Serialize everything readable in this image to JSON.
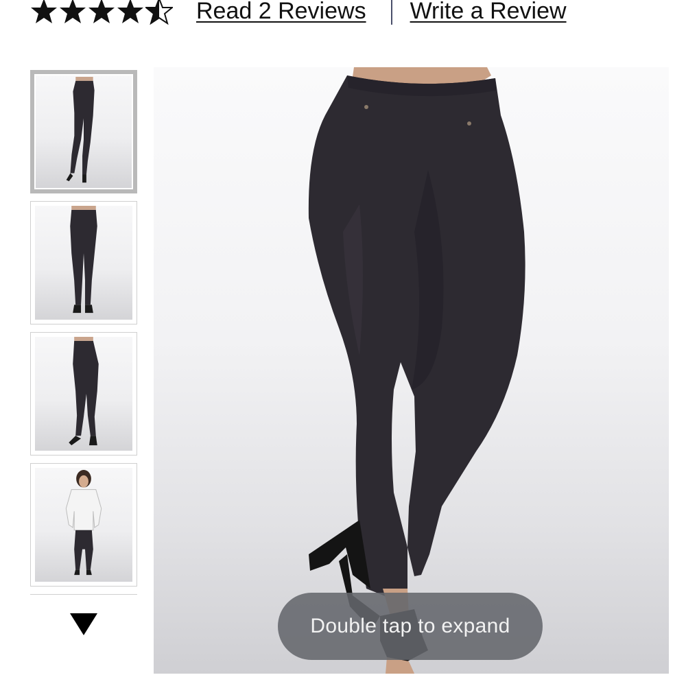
{
  "rating": {
    "stars_value": 4.5,
    "stars_max": 5,
    "star_color": "#111111"
  },
  "reviews": {
    "read_label": "Read 2 Reviews",
    "write_label": "Write a Review"
  },
  "gallery": {
    "thumbnails": [
      {
        "icon": "leggings-front-view-image",
        "selected": true
      },
      {
        "icon": "leggings-back-view-image",
        "selected": false
      },
      {
        "icon": "leggings-side-view-image",
        "selected": false
      },
      {
        "icon": "model-full-outfit-image",
        "selected": false
      }
    ],
    "scroll_icon": "triangle-down-icon",
    "main_image_icon": "leggings-product-image",
    "toast_text": "Double tap to expand"
  },
  "colors": {
    "leggings": "#2d2a31",
    "toast_bg": "#64666c",
    "separator": "#4a4f6a"
  }
}
